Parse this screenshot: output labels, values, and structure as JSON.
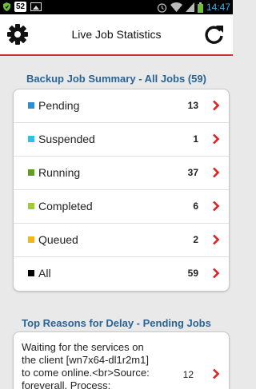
{
  "status_bar": {
    "badge": "52",
    "time": "14:47",
    "icons": [
      "shield-icon",
      "image-icon",
      "alarm-icon",
      "wifi-icon",
      "signal-icon",
      "battery-icon"
    ]
  },
  "header": {
    "title": "Live Job Statistics",
    "left_icon": "gear-icon",
    "right_icon": "refresh-icon",
    "accent_color": "#d32f2f"
  },
  "backup_summary": {
    "title": "Backup Job Summary - All Jobs (59)",
    "items": [
      {
        "label": "Pending",
        "count": "13",
        "color": "#2a8fd8"
      },
      {
        "label": "Suspended",
        "count": "1",
        "color": "#29c2e8"
      },
      {
        "label": "Running",
        "count": "37",
        "color": "#5f9e1f"
      },
      {
        "label": "Completed",
        "count": "6",
        "color": "#9ccc3c"
      },
      {
        "label": "Queued",
        "count": "2",
        "color": "#f4b41a"
      },
      {
        "label": "All",
        "count": "59",
        "color": "#000000"
      }
    ]
  },
  "delay_reasons": {
    "title": "Top Reasons for Delay - Pending Jobs",
    "items": [
      {
        "text": "Waiting for the services on\nthe client [wn7x64-dl1r2m1]\nto come online.<br>Source:\nforeverall, Process:",
        "count": "12"
      }
    ]
  }
}
